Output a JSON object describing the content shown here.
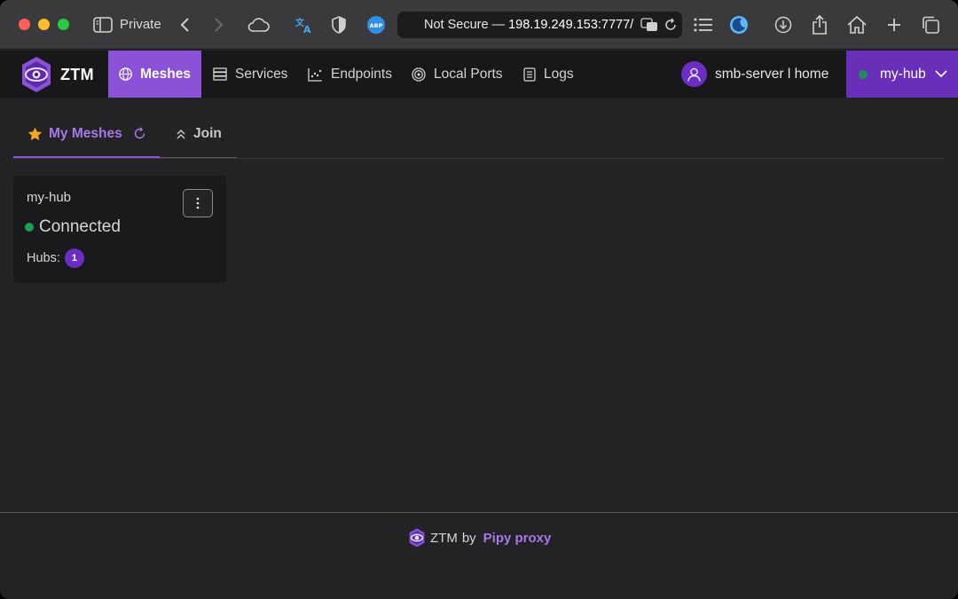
{
  "browser": {
    "private_label": "Private",
    "address": {
      "security": "Not Secure",
      "separator": "—",
      "host": "198.19.249.153:7777/"
    }
  },
  "app": {
    "brand": "ZTM",
    "nav": [
      {
        "label": "Meshes",
        "icon": "globe-icon",
        "active": true
      },
      {
        "label": "Services",
        "icon": "server-icon"
      },
      {
        "label": "Endpoints",
        "icon": "scatter-chart-icon"
      },
      {
        "label": "Local Ports",
        "icon": "target-icon"
      },
      {
        "label": "Logs",
        "icon": "document-icon"
      }
    ],
    "user_label": "smb-server l home",
    "hub_select": {
      "value": "my-hub",
      "status_color": "#1f8f5a"
    },
    "accent": "#8b52d8"
  },
  "tabs": {
    "my_meshes": "My Meshes",
    "join": "Join"
  },
  "mesh_card": {
    "name": "my-hub",
    "status": "Connected",
    "status_color": "#1f9d5c",
    "hubs_label": "Hubs:",
    "hubs_count": "1"
  },
  "footer": {
    "brand": "ZTM",
    "by": "by",
    "link": "Pipy proxy"
  }
}
